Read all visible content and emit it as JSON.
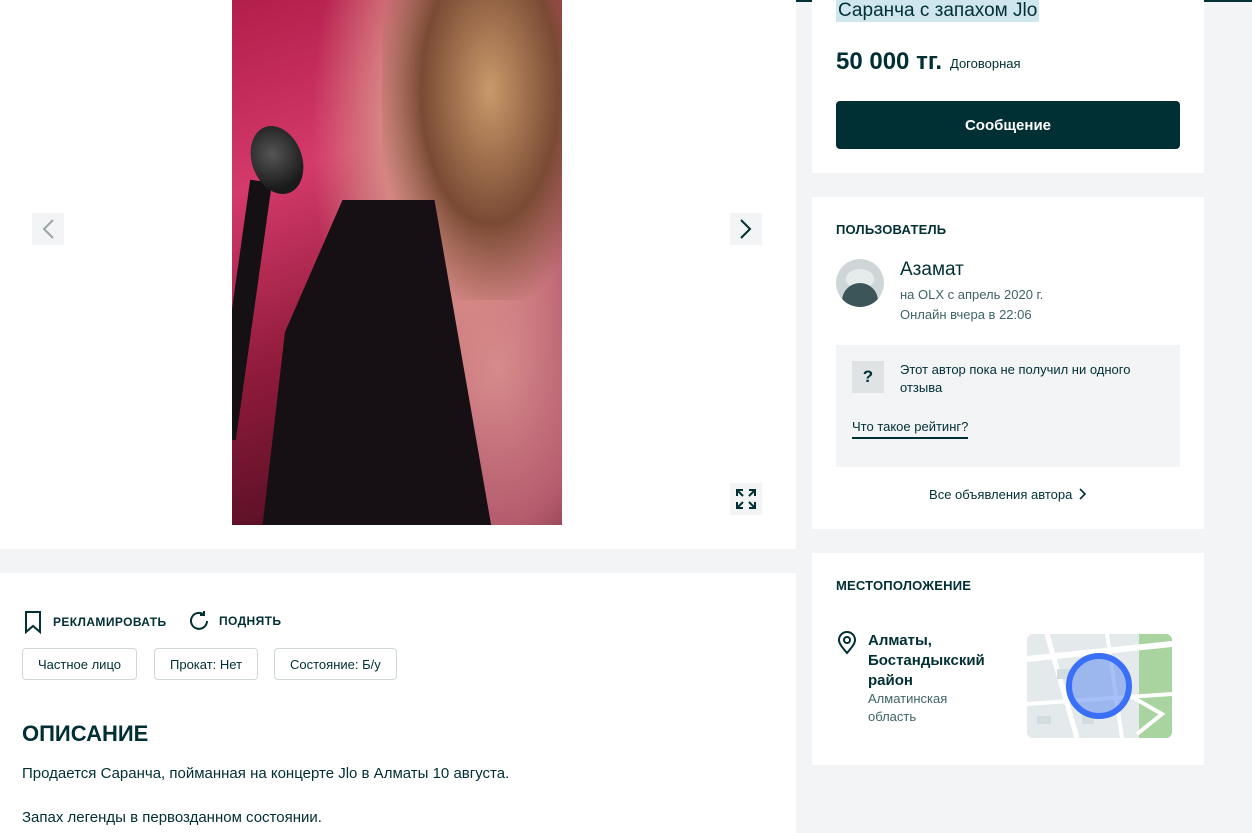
{
  "listing": {
    "title": "Саранча с запахом Jlo",
    "price": "50 000 тг.",
    "price_note": "Договорная",
    "message_button": "Сообщение"
  },
  "gallery": {
    "prev_icon": "chevron-left-icon",
    "next_icon": "chevron-right-icon",
    "expand_icon": "expand-icon"
  },
  "user": {
    "section_title": "ПОЛЬЗОВАТЕЛЬ",
    "name": "Азамат",
    "since": "на OLX с апрель 2020 г.",
    "online": "Онлайн вчера в 22:06",
    "rating_text": "Этот автор пока не получил ни одного отзыва",
    "rating_link": "Что такое рейтинг?",
    "all_ads": "Все объявления автора"
  },
  "location": {
    "section_title": "МЕСТОПОЛОЖЕНИЕ",
    "city": "Алматы, Бостандыкский район",
    "region": "Алматинская область"
  },
  "actions": {
    "promote": "РЕКЛАМИРОВАТЬ",
    "raise": "ПОДНЯТЬ"
  },
  "tags": [
    "Частное лицо",
    "Прокат: Нет",
    "Состояние: Б/у"
  ],
  "description": {
    "heading": "ОПИСАНИЕ",
    "lines": [
      "Продается Саранча, пойманная на концерте Jlo в Алматы 10 августа.",
      "Запах легенды в первозданном состоянии."
    ]
  },
  "colors": {
    "primary": "#002f34",
    "background": "#f2f4f5",
    "map_marker": "#3a6ff7"
  }
}
